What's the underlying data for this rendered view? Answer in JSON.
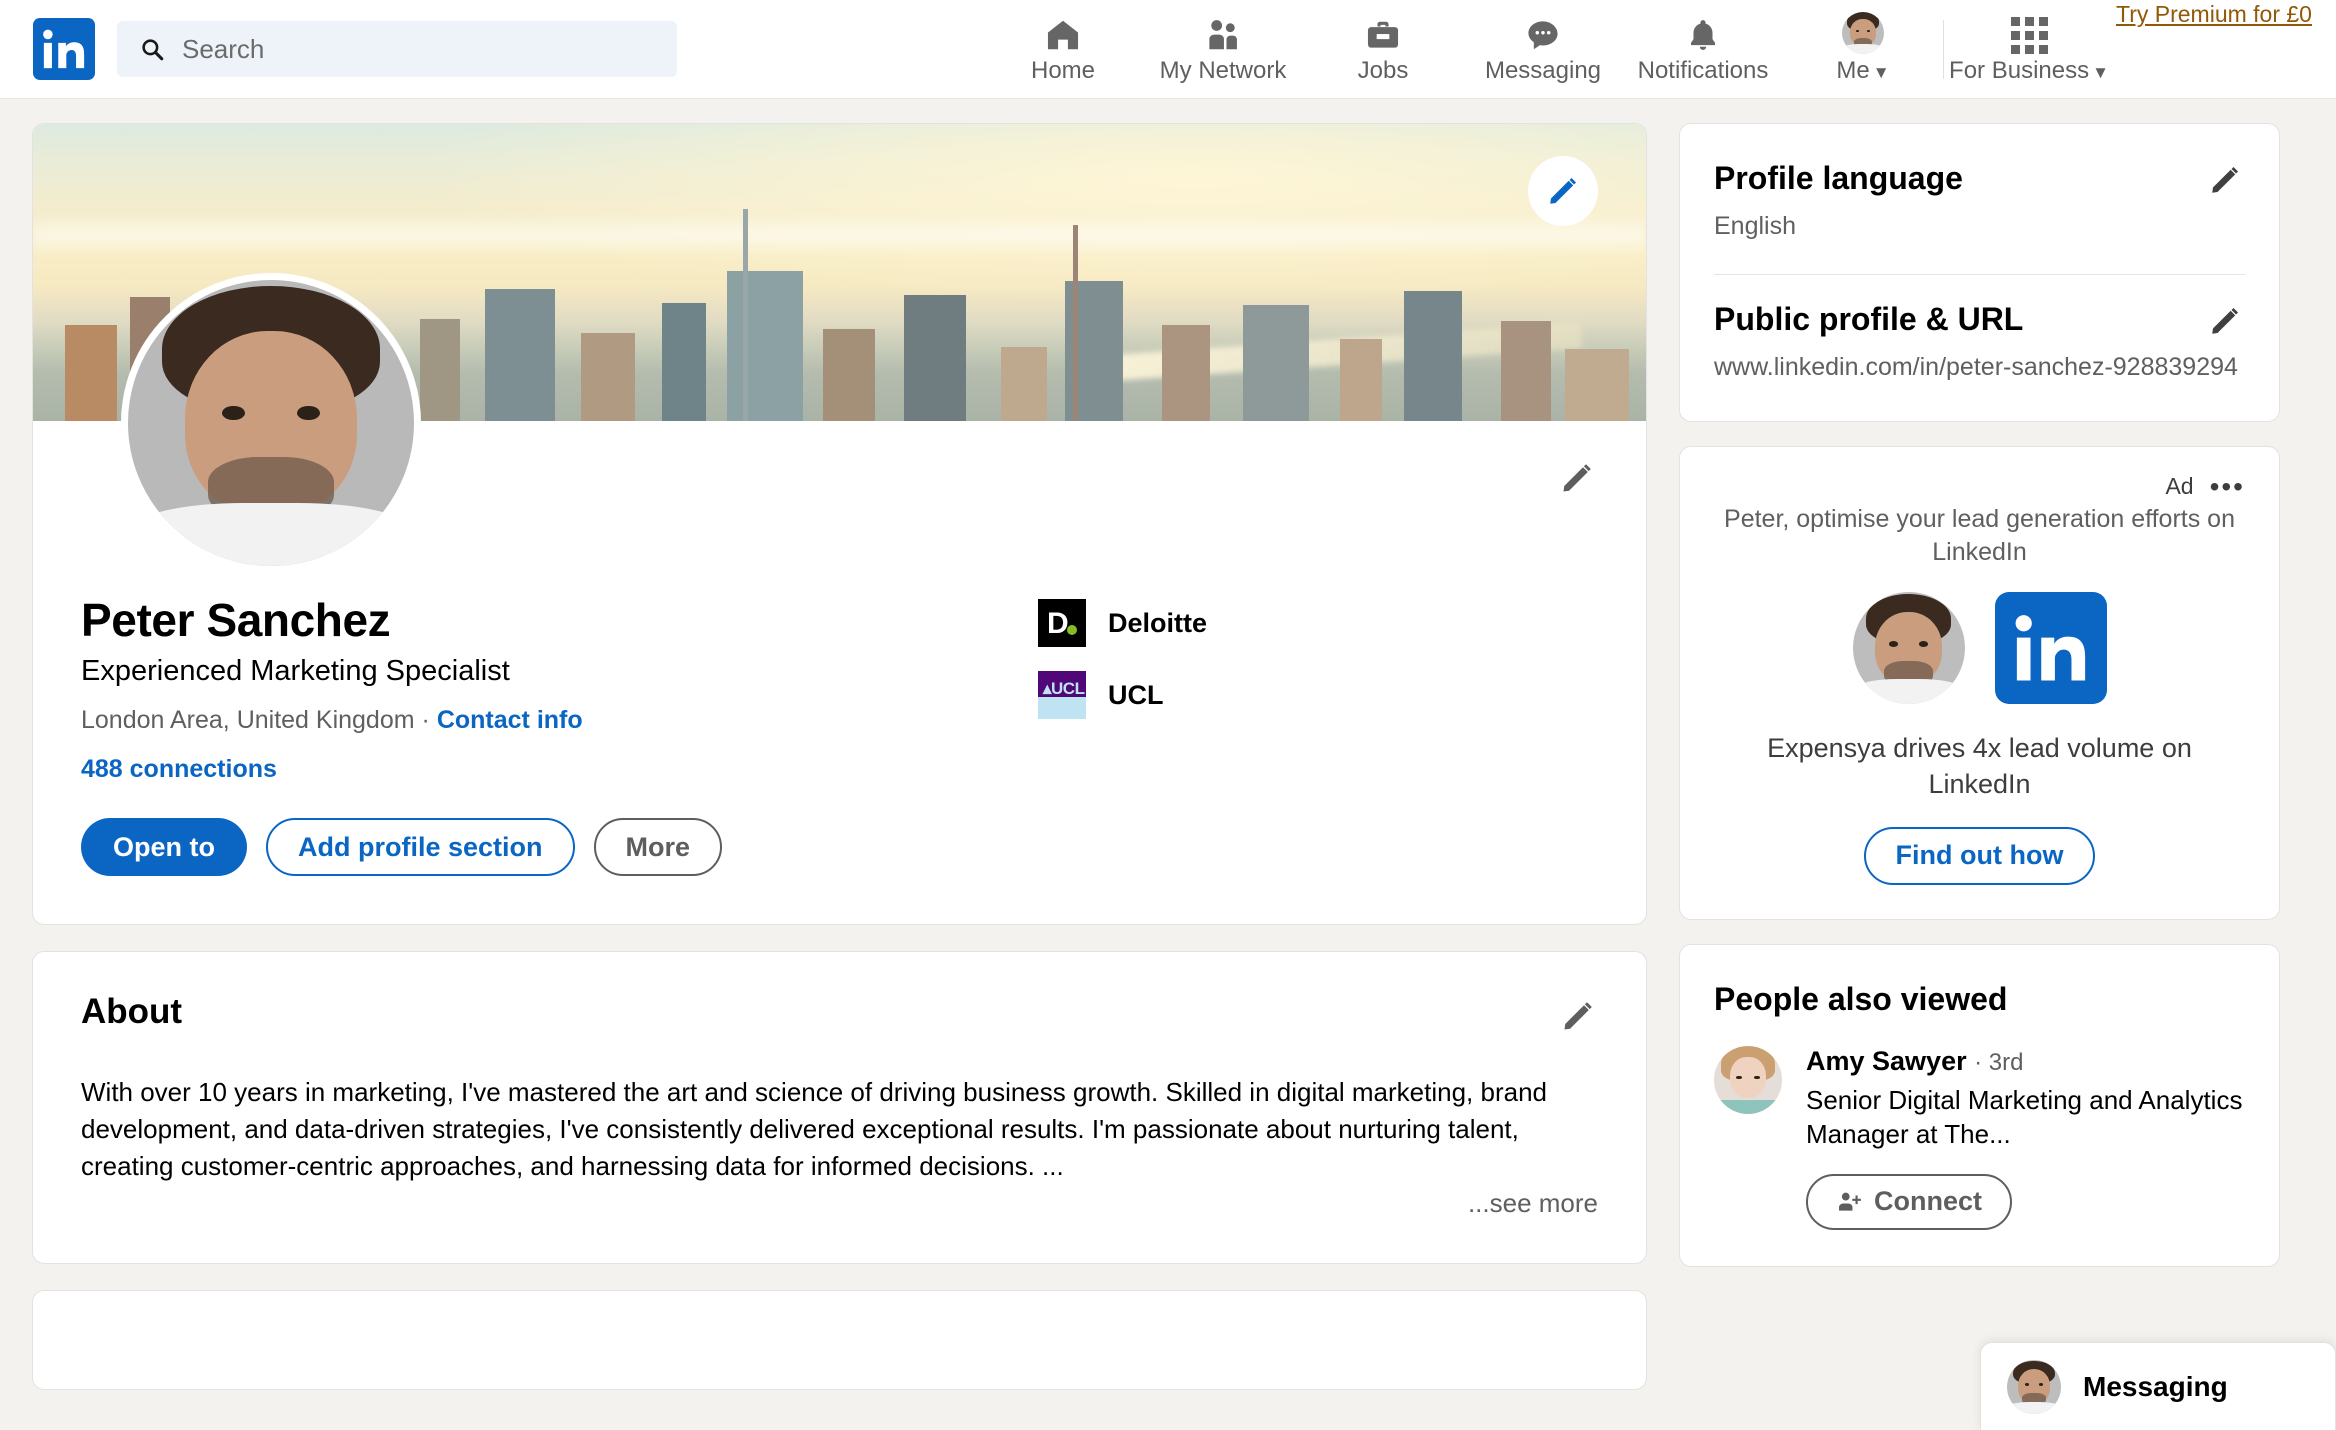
{
  "header": {
    "logo": "linkedin-logo",
    "search": {
      "placeholder": "Search",
      "value": ""
    },
    "nav": [
      {
        "label": "Home",
        "icon": "home-icon"
      },
      {
        "label": "My Network",
        "icon": "network-icon"
      },
      {
        "label": "Jobs",
        "icon": "briefcase-icon"
      },
      {
        "label": "Messaging",
        "icon": "chat-icon"
      },
      {
        "label": "Notifications",
        "icon": "bell-icon"
      },
      {
        "label": "Me",
        "icon": "avatar-icon",
        "caret": "▼"
      }
    ],
    "for_business": {
      "label": "For Business",
      "caret": "▼",
      "icon": "grid-icon"
    },
    "premium": "Try Premium for £0"
  },
  "profile": {
    "name": "Peter Sanchez",
    "headline": "Experienced Marketing Specialist",
    "location": "London Area, United Kingdom",
    "separator": "·",
    "contact_info": "Contact info",
    "connections": "488 connections",
    "buttons": {
      "open_to": "Open to",
      "add_section": "Add profile section",
      "more": "More"
    },
    "orgs": [
      {
        "name": "Deloitte",
        "logo": "deloitte-logo"
      },
      {
        "name": "UCL",
        "logo": "ucl-logo"
      }
    ]
  },
  "about": {
    "title": "About",
    "text": "With over 10 years in marketing, I've mastered the art and science of driving business growth. Skilled in digital marketing, brand development, and data-driven strategies, I've consistently delivered exceptional results. I'm passionate about nurturing talent, creating customer-centric approaches, and harnessing data for informed decisions. ...",
    "see_more": "...see more"
  },
  "sidebar": {
    "profile_language": {
      "title": "Profile language",
      "value": "English"
    },
    "public_url": {
      "title": "Public profile & URL",
      "value": "www.linkedin.com/in/peter-sanchez-928839294"
    },
    "ad": {
      "label": "Ad",
      "dots": "•••",
      "headline": "Peter, optimise your lead generation efforts on LinkedIn",
      "tagline": "Expensya drives 4x lead volume on LinkedIn",
      "cta": "Find out how"
    },
    "people_also_viewed": {
      "title": "People also viewed",
      "people": [
        {
          "name": "Amy Sawyer",
          "degree": "· 3rd",
          "headline": "Senior Digital Marketing and Analytics Manager at The...",
          "connect": "Connect"
        }
      ]
    }
  },
  "messaging_dock": {
    "title": "Messaging"
  },
  "colors": {
    "brand_blue": "#0a66c2",
    "premium_gold": "#915907",
    "page_bg": "#f4f2ee",
    "text_muted": "#5f5f5f",
    "deloitte_green": "#86bc25",
    "ucl_purple": "#500778"
  }
}
